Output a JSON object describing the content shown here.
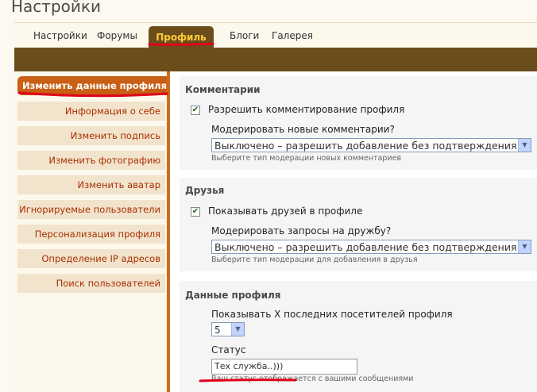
{
  "page": {
    "title": "Настройки"
  },
  "tabs": [
    {
      "label": "Настройки"
    },
    {
      "label": "Форумы"
    },
    {
      "label": "Профиль"
    },
    {
      "label": "Блоги"
    },
    {
      "label": "Галерея"
    }
  ],
  "sidebar": {
    "items": [
      {
        "label": "Изменить данные профиля"
      },
      {
        "label": "Информация о себе"
      },
      {
        "label": "Изменить подпись"
      },
      {
        "label": "Изменить фотографию"
      },
      {
        "label": "Изменить аватар"
      },
      {
        "label": "Игнорируемые пользователи"
      },
      {
        "label": "Персонализация профиля"
      },
      {
        "label": "Определение IP адресов"
      },
      {
        "label": "Поиск пользователей"
      }
    ]
  },
  "comments": {
    "title": "Комментарии",
    "allow_label": "Разрешить комментирование профиля",
    "allow_checked": true,
    "moderate_label": "Модерировать новые комментарии?",
    "moderate_value": "Выключено – разрешить добавление без подтверждения",
    "moderate_hint": "Выберите тип модерации новых комментариев"
  },
  "friends": {
    "title": "Друзья",
    "show_label": "Показывать друзей в профиле",
    "show_checked": true,
    "moderate_label": "Модерировать запросы на дружбу?",
    "moderate_value": "Выключено – разрешить добавление без подтверждения",
    "moderate_hint": "Выберите тип модерации для добавления в друзья"
  },
  "profile_data": {
    "title": "Данные профиля",
    "visitors_label": "Показывать X последних посетителей профиля",
    "visitors_value": "5",
    "status_label": "Статус",
    "status_value": "Тех служба..)))",
    "status_hint": "Ваш статус отображается с вашими сообщениями"
  },
  "colors": {
    "accent_brown": "#6b4d1c",
    "active_orange": "#c85f15",
    "tab_active_text": "#ffcc33",
    "annotation_red": "#e0001a"
  }
}
